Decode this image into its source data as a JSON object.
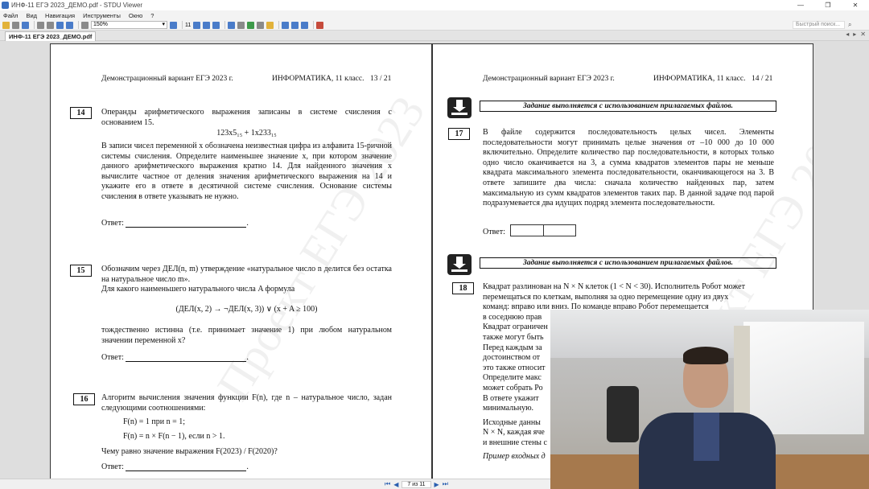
{
  "window": {
    "title": "ИНФ-11 ЕГЭ 2023_ДЕМО.pdf - STDU Viewer",
    "controls": [
      "—",
      "❐",
      "✕"
    ]
  },
  "menu": {
    "items": [
      "Файл",
      "Вид",
      "Навигация",
      "Инструменты",
      "Окно",
      "?"
    ]
  },
  "toolbar": {
    "zoom": "150%",
    "page_count": "11",
    "search_placeholder": "Быстрый поиск..."
  },
  "tab": {
    "label": "ИНФ-11 ЕГЭ 2023_ДЕМО.pdf",
    "nav": [
      "◂",
      "▸",
      "✕"
    ]
  },
  "left_page": {
    "header_left": "Демонстрационный вариант ЕГЭ 2023 г.",
    "header_right": "ИНФОРМАТИКА, 11 класс.",
    "page_num": "13 / 21",
    "watermark": "Проект ЕГЭ 2023",
    "q14": {
      "num": "14",
      "text1": "Операнды арифметического выражения записаны в системе счисления с основанием 15.",
      "formula": "123x5₁₅ + 1x233₁₅",
      "text2": "В записи чисел переменной x обозначена неизвестная цифра из алфавита 15-ричной системы счисления. Определите наименьшее значение x, при котором значение данного арифметического выражения кратно 14. Для найденного значения x вычислите частное от деления значения арифметического выражения на 14 и укажите его в ответе в десятичной системе счисления. Основание системы счисления в ответе указывать не нужно.",
      "answer_label": "Ответ:"
    },
    "q15": {
      "num": "15",
      "text1": "Обозначим через ДЕЛ(n, m) утверждение «натуральное число n делится без остатка на натуральное число m».",
      "text2": "Для какого наименьшего натурального числа A формула",
      "formula": "(ДЕЛ(x, 2) → ¬ДЕЛ(x, 3)) ∨ (x + A ≥ 100)",
      "text3": "тождественно истинна (т.е. принимает значение 1) при любом натуральном значении переменной x?",
      "answer_label": "Ответ:"
    },
    "q16": {
      "num": "16",
      "text1": "Алгоритм вычисления значения функции F(n), где n – натуральное число, задан следующими соотношениями:",
      "rule1": "F(n) = 1 при n = 1;",
      "rule2": "F(n) = n × F(n − 1), если n > 1.",
      "text2": "Чему равно значение выражения F(2023) / F(2020)?",
      "answer_label": "Ответ:"
    }
  },
  "right_page": {
    "header_left": "Демонстрационный вариант ЕГЭ 2023 г.",
    "header_right": "ИНФОРМАТИКА, 11 класс.",
    "page_num": "14 / 21",
    "watermark": "Проект ЕГЭ 2023",
    "banner1": "Задание выполняется с использованием прилагаемых файлов.",
    "banner2": "Задание выполняется с использованием прилагаемых файлов.",
    "q17": {
      "num": "17",
      "text": "В файле содержится последовательность целых чисел. Элементы последовательности могут принимать целые значения от –10 000 до 10 000 включительно. Определите количество пар последовательности, в которых только одно число оканчивается на 3, а сумма квадратов элементов пары не меньше квадрата максимального элемента последовательности, оканчивающегося на 3. В ответе запишите два числа: сначала количество найденных пар, затем максимальную из сумм квадратов элементов таких пар. В данной задаче под парой подразумевается два идущих подряд элемента последовательности.",
      "answer_label": "Ответ:"
    },
    "q18": {
      "num": "18",
      "lines": [
        "Квадрат разлинован на N × N клеток (1 < N < 30). Исполнитель Робот может",
        "перемещаться по клеткам, выполняя за одно перемещение одну из двух",
        "команд: вправо или вниз. По команде вправо Робот перемещается",
        "в соседнюю прав",
        "Квадрат ограничен",
        "также могут быть",
        "Перед каждым за",
        "достоинством от",
        "это также относит",
        "Определите макс",
        "может собрать Ро",
        "В ответе укажит",
        "минимальную.",
        "Исходные данны",
        "N × N, каждая яче",
        "и внешние стены с",
        "Пример входных д"
      ]
    }
  },
  "status": {
    "page_indicator": "7 из 11",
    "nav_first": "⏮",
    "nav_prev": "◀",
    "nav_next": "▶",
    "nav_last": "⏭"
  }
}
